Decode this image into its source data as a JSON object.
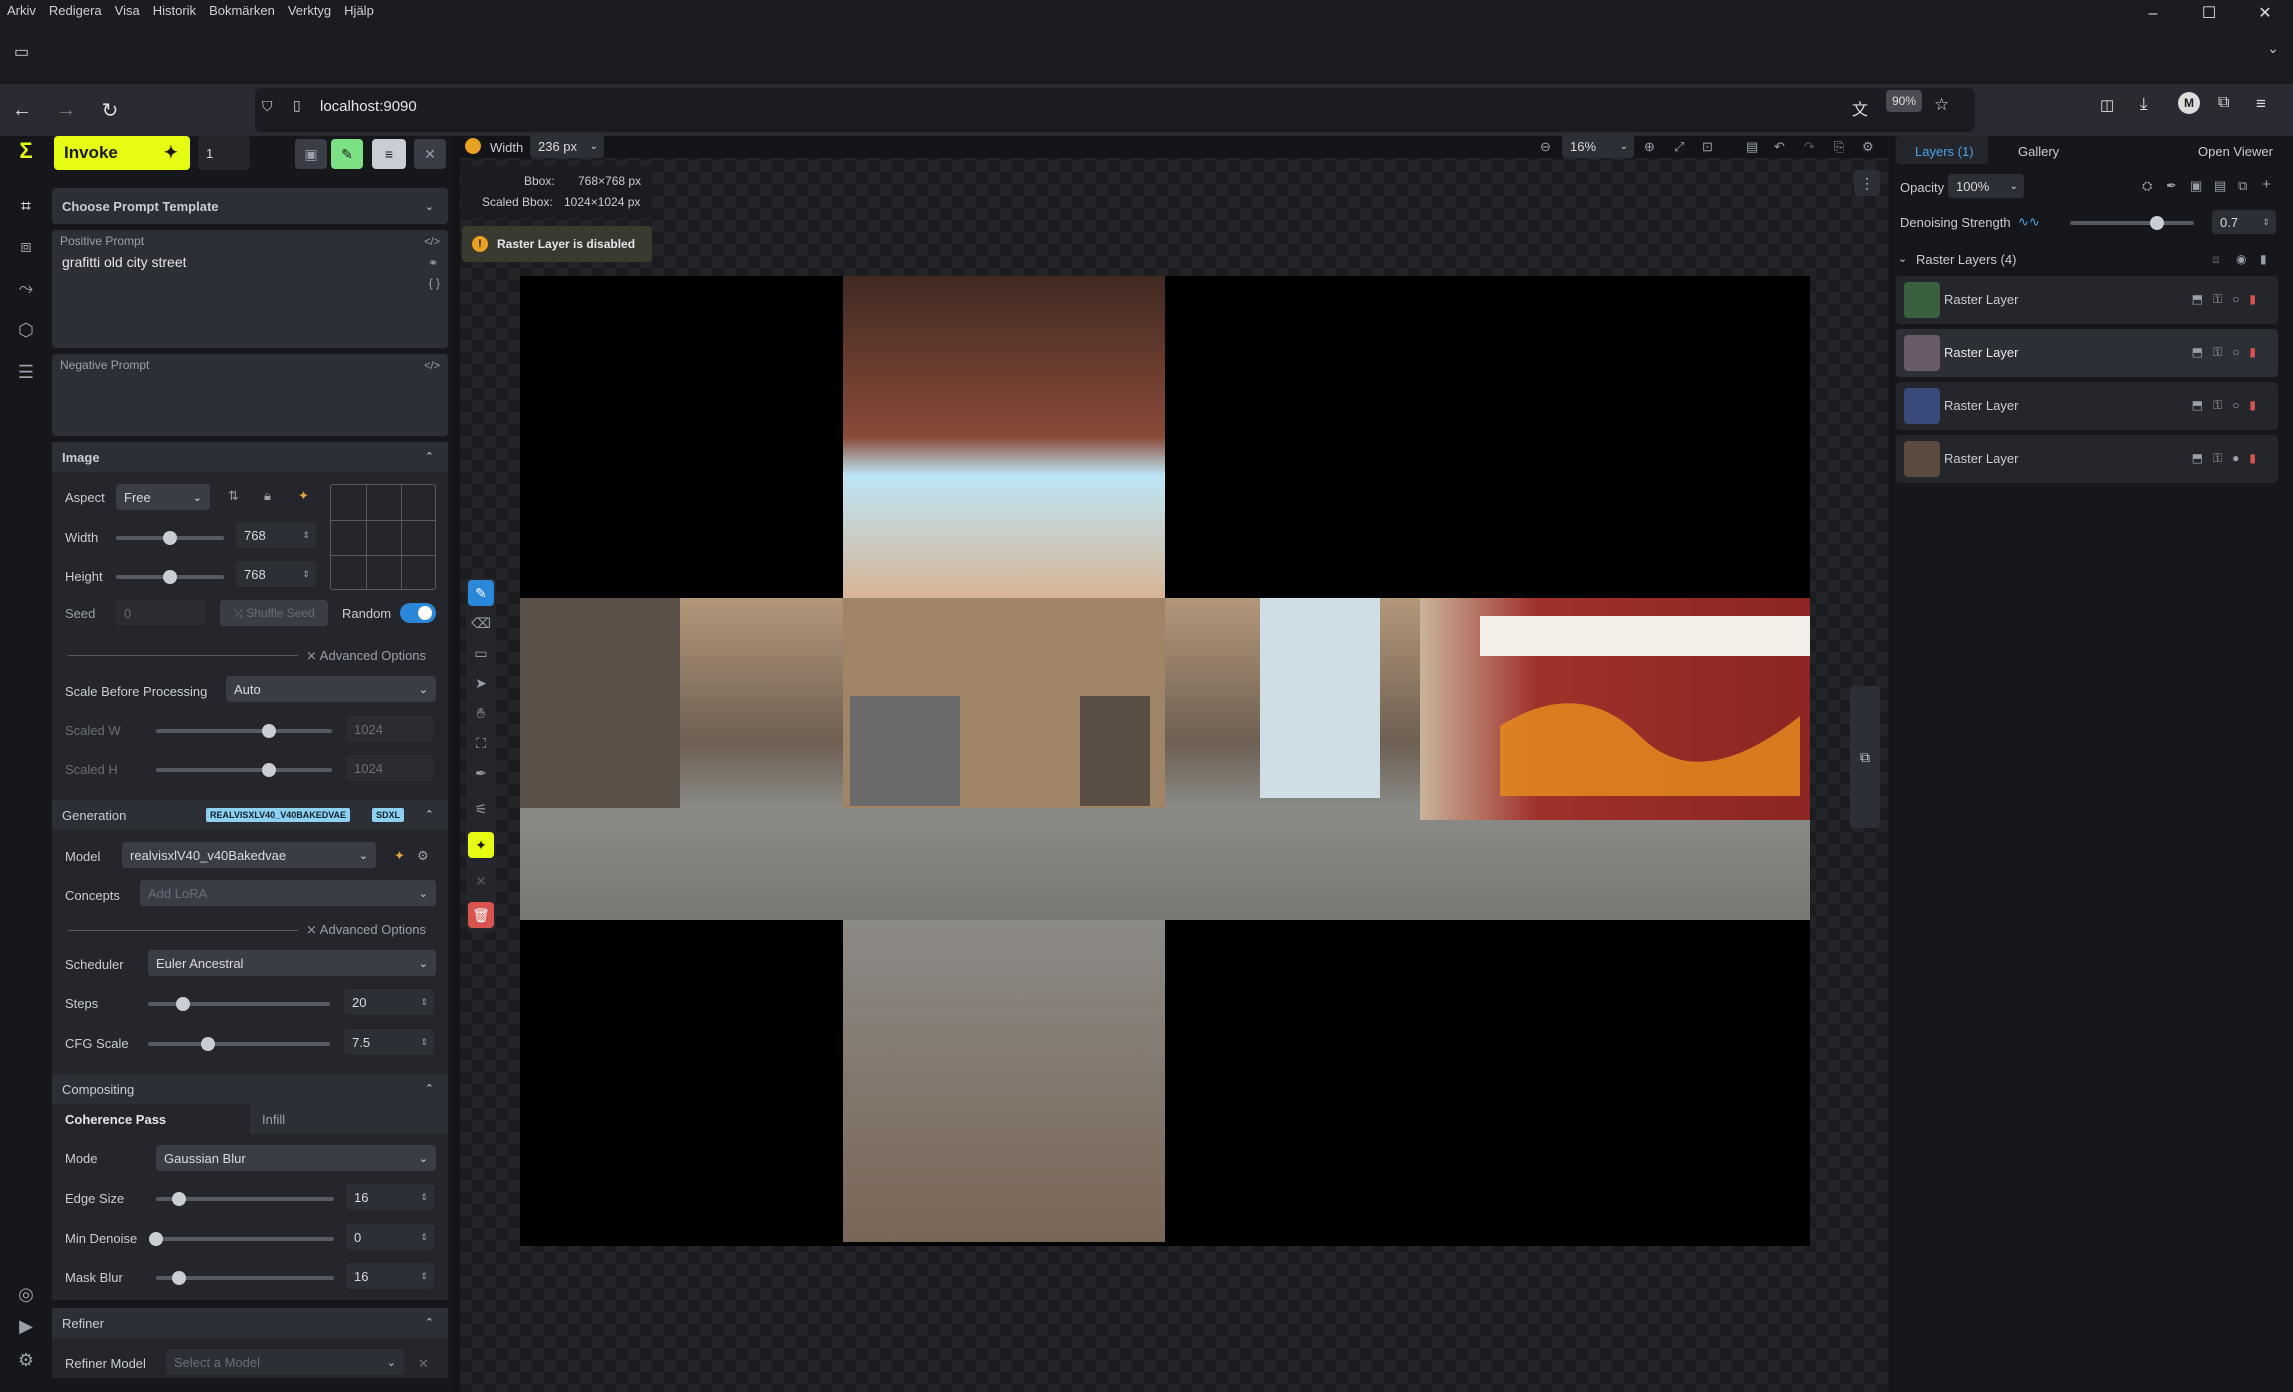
{
  "browser": {
    "menu": [
      "Arkiv",
      "Redigera",
      "Visa",
      "Historik",
      "Bokmärken",
      "Verktyg",
      "Hjälp"
    ],
    "url": "localhost:9090",
    "zoom": "90%"
  },
  "toolbar": {
    "invoke_label": "Invoke",
    "queue_count": "1",
    "width_label": "Width",
    "width_value": "236 px",
    "zoom_value": "16%"
  },
  "left": {
    "prompt_template": "Choose Prompt Template",
    "positive_label": "Positive Prompt",
    "positive_value": "grafitti old city street",
    "negative_label": "Negative Prompt",
    "image": {
      "section": "Image",
      "aspect_label": "Aspect",
      "aspect_value": "Free",
      "width_label": "Width",
      "width_value": "768",
      "width_frac": 0.5,
      "height_label": "Height",
      "height_value": "768",
      "height_frac": 0.5,
      "seed_label": "Seed",
      "seed_value": "0",
      "shuffle_label": "Shuffle Seed",
      "random_label": "Random",
      "advanced": "Advanced Options",
      "scale_label": "Scale Before Processing",
      "scale_value": "Auto",
      "scaled_w_label": "Scaled W",
      "scaled_w_value": "1024",
      "scaled_w_frac": 0.64,
      "scaled_h_label": "Scaled H",
      "scaled_h_value": "1024",
      "scaled_h_frac": 0.64
    },
    "generation": {
      "section": "Generation",
      "badge_model": "REALVISXLV40_V40BAKEDVAE",
      "badge_base": "SDXL",
      "model_label": "Model",
      "model_value": "realvisxlV40_v40Bakedvae",
      "concepts_label": "Concepts",
      "concepts_placeholder": "Add LoRA",
      "advanced": "Advanced Options",
      "scheduler_label": "Scheduler",
      "scheduler_value": "Euler Ancestral",
      "steps_label": "Steps",
      "steps_value": "20",
      "steps_frac": 0.19,
      "cfg_label": "CFG Scale",
      "cfg_value": "7.5",
      "cfg_frac": 0.33
    },
    "compositing": {
      "section": "Compositing",
      "tab_coherence": "Coherence Pass",
      "tab_infill": "Infill",
      "mode_label": "Mode",
      "mode_value": "Gaussian Blur",
      "edge_label": "Edge Size",
      "edge_value": "16",
      "edge_frac": 0.13,
      "min_label": "Min Denoise",
      "min_value": "0",
      "min_frac": 0.0,
      "mask_label": "Mask Blur",
      "mask_value": "16",
      "mask_frac": 0.13
    },
    "refiner": {
      "section": "Refiner",
      "model_label": "Refiner Model",
      "model_placeholder": "Select a Model"
    }
  },
  "canvas": {
    "bbox_label": "Bbox:",
    "bbox_value": "768×768 px",
    "scaled_label": "Scaled Bbox:",
    "scaled_value": "1024×1024 px",
    "warning": "Raster Layer is disabled"
  },
  "right": {
    "tab_layers": "Layers (1)",
    "tab_gallery": "Gallery",
    "open_viewer": "Open Viewer",
    "opacity_label": "Opacity",
    "opacity_value": "100%",
    "denoise_label": "Denoising Strength",
    "denoise_value": "0.7",
    "denoise_frac": 0.7,
    "group_label": "Raster Layers (4)",
    "layers": [
      {
        "name": "Raster Layer"
      },
      {
        "name": "Raster Layer"
      },
      {
        "name": "Raster Layer"
      },
      {
        "name": "Raster Layer"
      }
    ]
  },
  "colors": {
    "accent": "#e6fd13",
    "active": "#7ce085",
    "blue": "#2b87d9",
    "danger": "#d9534f"
  }
}
